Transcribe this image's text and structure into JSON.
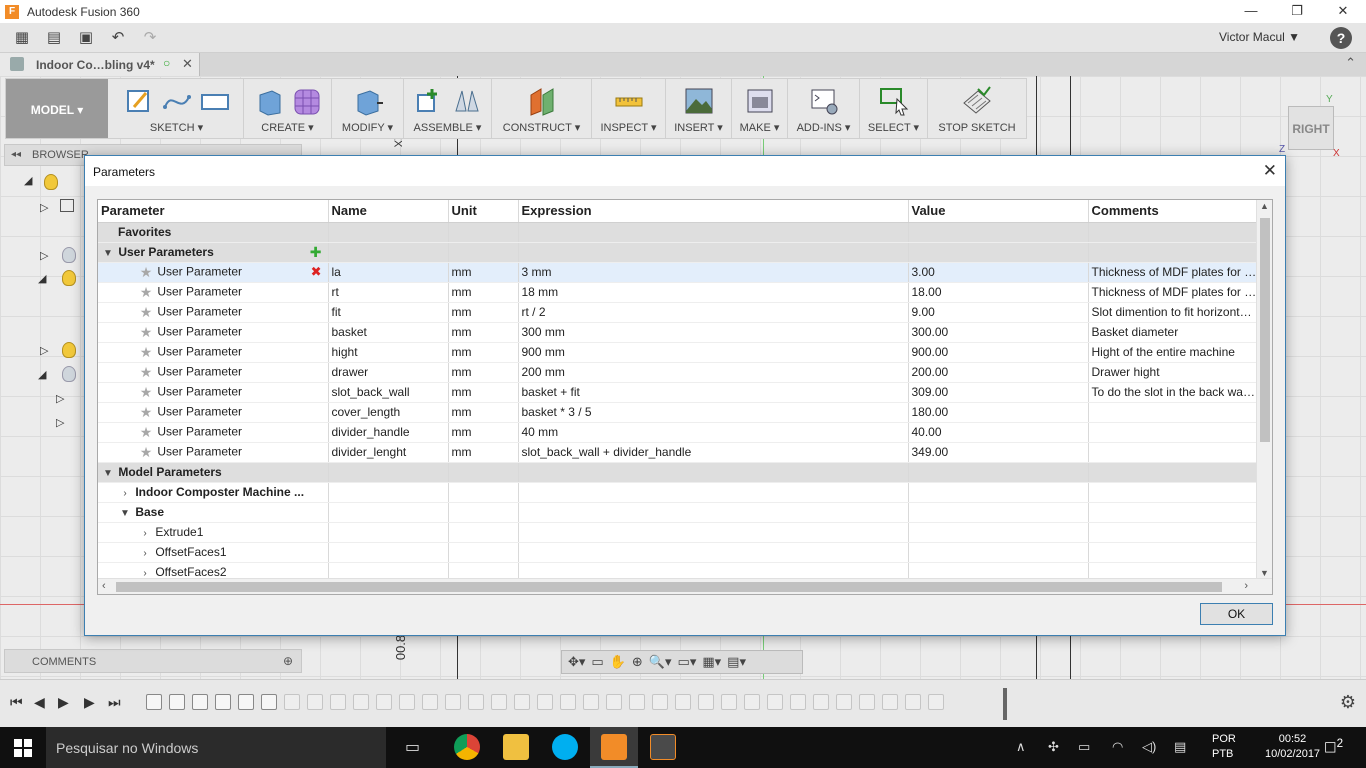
{
  "app": {
    "title": "Autodesk Fusion 360",
    "icon_letter": "F"
  },
  "window_controls": {
    "minimize": "—",
    "maximize": "❐",
    "close": "✕"
  },
  "quickbar": {
    "user": "Victor Macul ▼",
    "help": "?"
  },
  "doc_tab": {
    "title": "Indoor Co…bling v4*"
  },
  "toolbar": {
    "mode": "MODEL ▾",
    "groups": [
      "SKETCH ▾",
      "CREATE ▾",
      "MODIFY ▾",
      "ASSEMBLE ▾",
      "CONSTRUCT ▾",
      "INSPECT ▾",
      "INSERT ▾",
      "MAKE ▾",
      "ADD-INS ▾",
      "SELECT ▾",
      "STOP SKETCH"
    ]
  },
  "viewcube": {
    "face": "RIGHT",
    "axis_z": "Z",
    "axis_y": "Y",
    "axis_x": "X"
  },
  "browser": {
    "label": "BROWSER"
  },
  "comments": {
    "label": "COMMENTS"
  },
  "sketch_dims": {
    "top": "XX",
    "bottom": "00.8"
  },
  "dialog": {
    "title": "Parameters",
    "close": "✕",
    "ok_label": "OK",
    "columns": [
      "Parameter",
      "Name",
      "Unit",
      "Expression",
      "Value",
      "Comments"
    ],
    "favorites_label": "Favorites",
    "user_params_label": "User Parameters",
    "user_rows": [
      {
        "type": "User Parameter",
        "name": "la",
        "unit": "mm",
        "expression": "3 mm",
        "value": "3.00",
        "comment": "Thickness of MDF plates for lase"
      },
      {
        "type": "User Parameter",
        "name": "rt",
        "unit": "mm",
        "expression": "18 mm",
        "value": "18.00",
        "comment": "Thickness of MDF plates for rou..."
      },
      {
        "type": "User Parameter",
        "name": "fit",
        "unit": "mm",
        "expression": "rt / 2",
        "value": "9.00",
        "comment": "Slot dimention to fit horizontal ..."
      },
      {
        "type": "User Parameter",
        "name": "basket",
        "unit": "mm",
        "expression": "300 mm",
        "value": "300.00",
        "comment": "Basket diameter"
      },
      {
        "type": "User Parameter",
        "name": "hight",
        "unit": "mm",
        "expression": "900 mm",
        "value": "900.00",
        "comment": "Hight of the entire machine"
      },
      {
        "type": "User Parameter",
        "name": "drawer",
        "unit": "mm",
        "expression": "200 mm",
        "value": "200.00",
        "comment": "Drawer hight"
      },
      {
        "type": "User Parameter",
        "name": "slot_back_wall",
        "unit": "mm",
        "expression": "basket + fit",
        "value": "309.00",
        "comment": "To do the slot in the back wall to..."
      },
      {
        "type": "User Parameter",
        "name": "cover_length",
        "unit": "mm",
        "expression": "basket * 3 / 5",
        "value": "180.00",
        "comment": ""
      },
      {
        "type": "User Parameter",
        "name": "divider_handle",
        "unit": "mm",
        "expression": "40 mm",
        "value": "40.00",
        "comment": ""
      },
      {
        "type": "User Parameter",
        "name": "divider_lenght",
        "unit": "mm",
        "expression": "slot_back_wall + divider_handle",
        "value": "349.00",
        "comment": ""
      }
    ],
    "model_params_label": "Model Parameters",
    "model_nodes": [
      {
        "label": "Indoor Composter Machine ...",
        "level": 1,
        "expanded": false,
        "bold": true
      },
      {
        "label": "Base",
        "level": 1,
        "expanded": true,
        "bold": true
      },
      {
        "label": "Extrude1",
        "level": 2,
        "expanded": false,
        "bold": false
      },
      {
        "label": "OffsetFaces1",
        "level": 2,
        "expanded": false,
        "bold": false
      },
      {
        "label": "OffsetFaces2",
        "level": 2,
        "expanded": false,
        "bold": false
      }
    ]
  },
  "taskbar": {
    "search_placeholder": "Pesquisar no Windows",
    "lang_1": "POR",
    "lang_2": "PTB",
    "time": "00:52",
    "date": "10/02/2017",
    "notifications": "2"
  }
}
